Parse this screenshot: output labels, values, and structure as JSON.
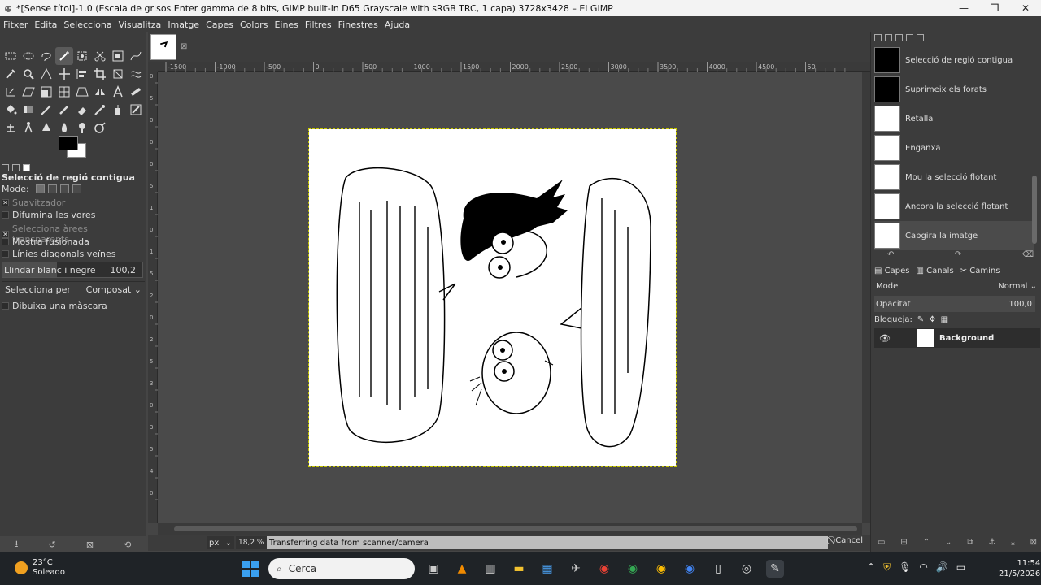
{
  "window": {
    "title": "*[Sense títol]-1.0 (Escala de grisos Enter gamma de 8 bits, GIMP built-in D65 Grayscale with sRGB TRC, 1 capa) 3728x3428 – El GIMP",
    "minimize": "—",
    "maximize": "❐",
    "close": "✕"
  },
  "menu": [
    "Fitxer",
    "Edita",
    "Selecciona",
    "Visualitza",
    "Imatge",
    "Capes",
    "Colors",
    "Eines",
    "Filtres",
    "Finestres",
    "Ajuda"
  ],
  "tool_options": {
    "title": "Selecció de regió contigua",
    "mode_label": "Mode:",
    "antialias": "Suavitzador",
    "feather": "Difumina les vores",
    "select_transparent": "Selecciona àrees transparents",
    "sample_merged": "Mostra fusionada",
    "diagonal_neighbors": "Línies diagonals veïnes",
    "threshold_label": "Llindar blanc i negre",
    "threshold_value": "100,2",
    "threshold_fraction": 0.39,
    "select_by_label": "Selecciona per",
    "select_by_value": "Composat",
    "draw_mask": "Dibuixa una màscara"
  },
  "ruler_h": [
    "-1500",
    "-1000",
    "-500",
    "0",
    "500",
    "1000",
    "1500",
    "2000",
    "2500",
    "3000",
    "3500",
    "4000",
    "4500",
    "50"
  ],
  "ruler_v": [
    "0",
    "5",
    "0",
    "0",
    "0",
    "5",
    "1",
    "0",
    "1",
    "5",
    "2",
    "0",
    "2",
    "5",
    "3",
    "0",
    "3",
    "5",
    "4",
    "0"
  ],
  "status": {
    "unit": "px",
    "zoom": "18,2 %",
    "message": "Transferring data from scanner/camera",
    "cancel": "Cancel"
  },
  "undo_history": [
    {
      "label": "Selecció de regió contigua",
      "dark": true
    },
    {
      "label": "Suprimeix els forats",
      "dark": true
    },
    {
      "label": "Retalla",
      "dark": false
    },
    {
      "label": "Enganxa",
      "dark": false
    },
    {
      "label": "Mou la selecció flotant",
      "dark": false
    },
    {
      "label": "Ancora la selecció flotant",
      "dark": false
    },
    {
      "label": "Capgira la imatge",
      "dark": false,
      "active": true
    }
  ],
  "layers_panel": {
    "tabs": [
      "Capes",
      "Canals",
      "Camins"
    ],
    "mode_label": "Mode",
    "mode_value": "Normal",
    "opacity_label": "Opacitat",
    "opacity_value": "100,0",
    "lock_label": "Bloqueja:",
    "layer_name": "Background"
  },
  "taskbar": {
    "temperature": "23°C",
    "weather": "Soleado",
    "search_placeholder": "Cerca",
    "time": "11:54",
    "date": "21/5/2026"
  }
}
